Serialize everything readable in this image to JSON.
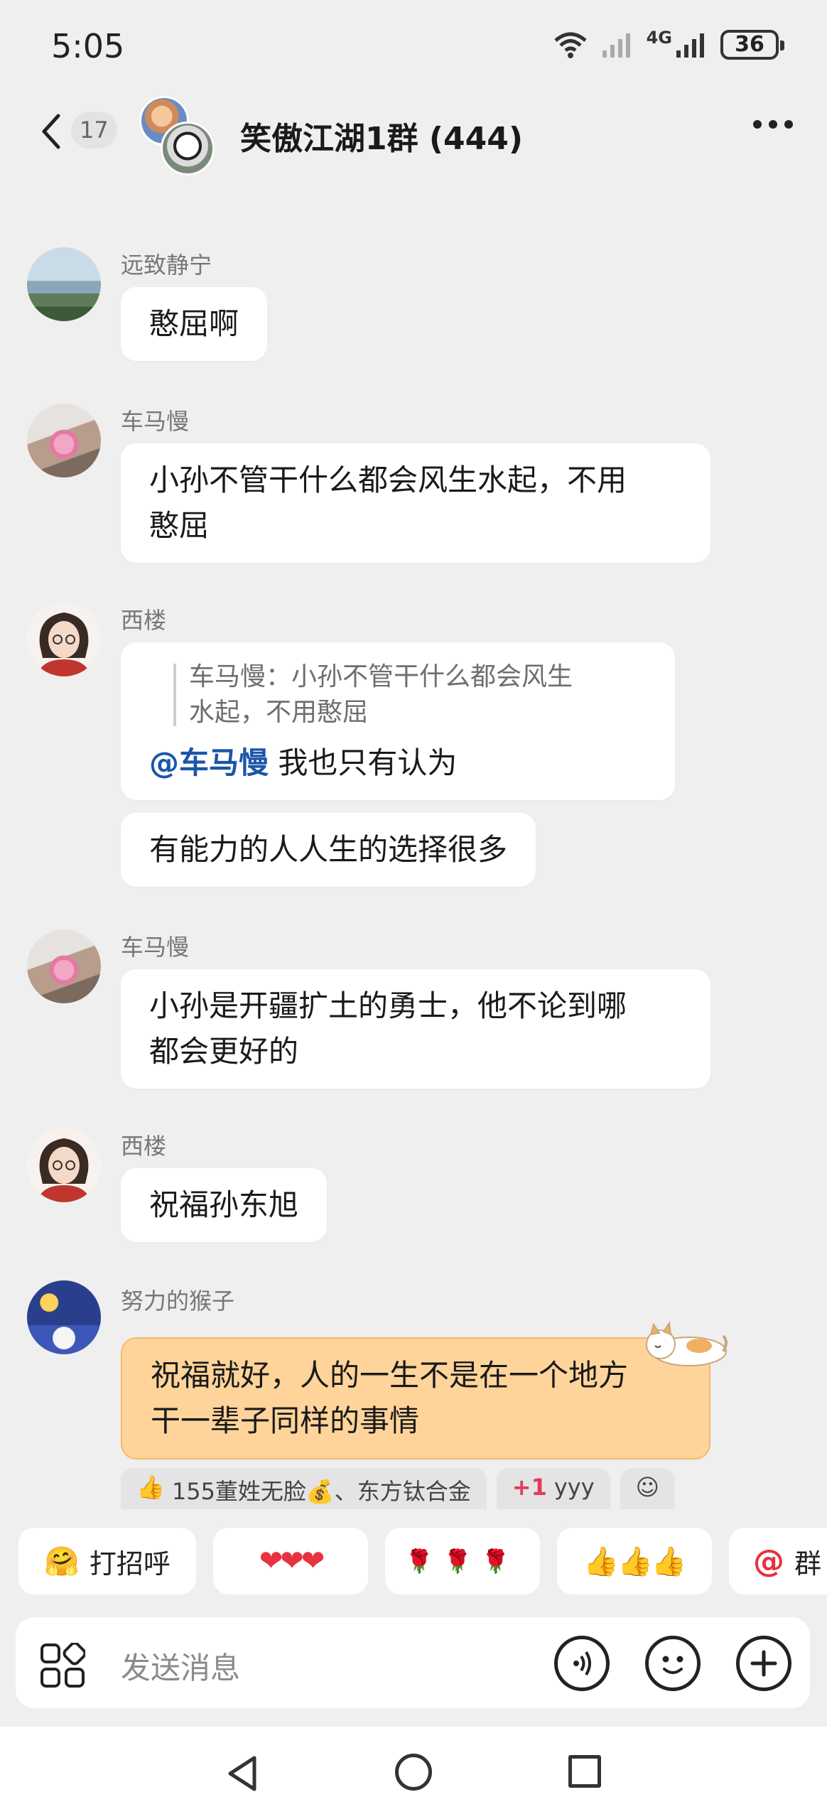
{
  "status_bar": {
    "time": "5:05",
    "network": "4G",
    "battery": "36"
  },
  "header": {
    "unread_count": "17",
    "title": "笑傲江湖1群 (444)"
  },
  "messages": [
    {
      "sender": "远致静宁",
      "text": "憨屈啊"
    },
    {
      "sender": "车马慢",
      "text_lines": [
        "小孙不管干什么都会风生水起，不用",
        "憨屈"
      ]
    },
    {
      "sender": "西楼",
      "quote_lines": [
        "车马慢：小孙不管干什么都会风生",
        "水起，不用憨屈"
      ],
      "mention": "@车马慢",
      "text": " 我也只有认为"
    },
    {
      "text": "有能力的人人生的选择很多"
    },
    {
      "sender": "车马慢",
      "text_lines": [
        "小孙是开疆扩土的勇士，他不论到哪",
        "都会更好的"
      ]
    },
    {
      "sender": "西楼",
      "text": "祝福孙东旭"
    },
    {
      "sender": "努力的猴子",
      "text_lines": [
        "祝福就好，人的一生不是在一个地方",
        "干一辈子同样的事情"
      ]
    }
  ],
  "reactions": {
    "names": "155董姓无脸💰、东方钛合金",
    "plus_one": "+1",
    "user": "yyy"
  },
  "quick_replies": {
    "greet": "打招呼",
    "hearts": "❤❤❤",
    "roses": "🌹🌹🌹",
    "thumbs": "👍👍👍",
    "at_group": "群"
  },
  "input": {
    "placeholder": "发送消息"
  },
  "colors": {
    "background": "#efefef",
    "bubble": "#ffffff",
    "highlight_bubble": "#ffd49a",
    "mention": "#1a56a8"
  }
}
